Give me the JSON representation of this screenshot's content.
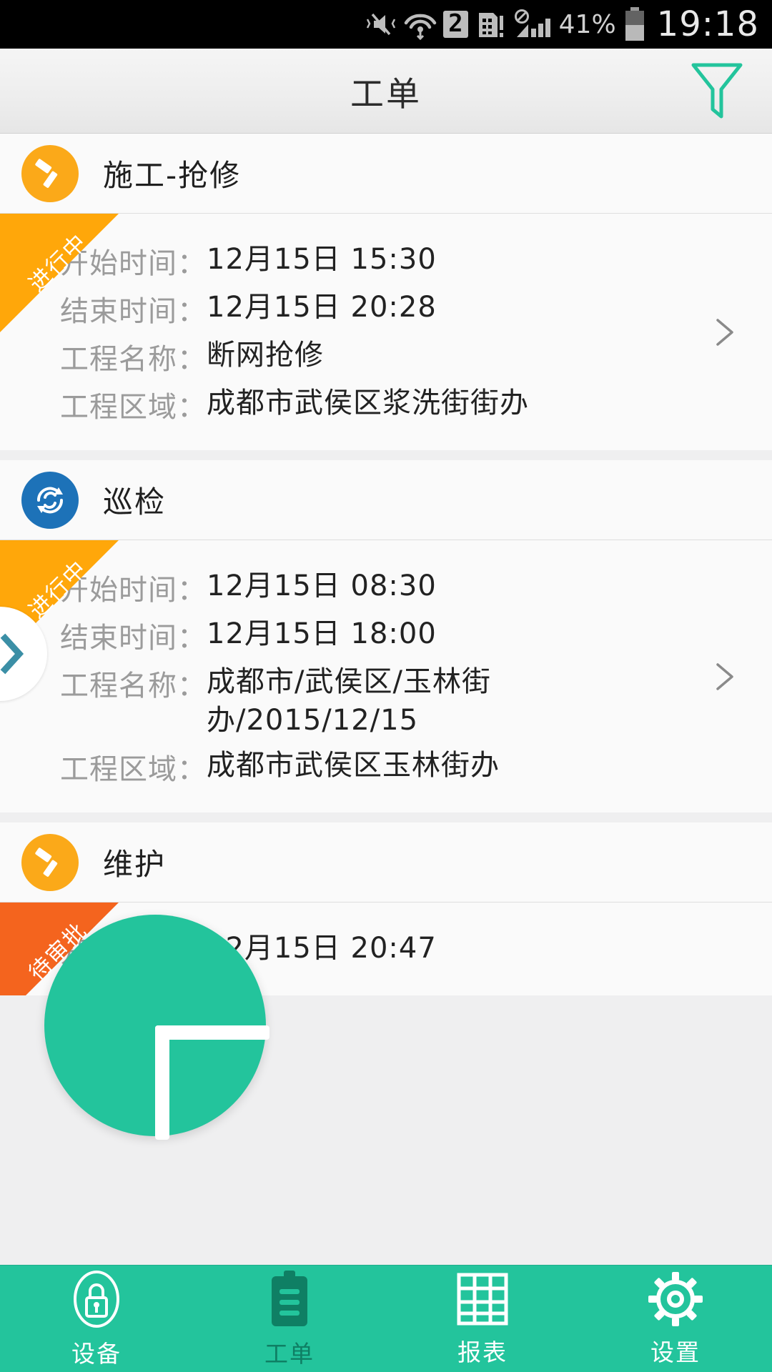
{
  "statusbar": {
    "sim_badge": "2",
    "battery_percent": "41%",
    "clock": "19:18",
    "icons": [
      "vibrate-mute-icon",
      "wifi-icon",
      "sim-2-icon",
      "sd-card-alert-icon",
      "no-signal-icon",
      "signal-bars-icon",
      "battery-icon"
    ]
  },
  "header": {
    "title": "工单",
    "filter_icon": "filter-funnel-icon",
    "accent_color": "#23C49C"
  },
  "labels": {
    "start_time": "开始时间：",
    "end_time": "结束时间：",
    "project_name": "工程名称：",
    "project_area": "工程区域："
  },
  "status_colors": {
    "in_progress": "#FFA70A",
    "pending_approval": "#F4641E"
  },
  "cards": [
    {
      "icon": "hammer-icon",
      "icon_color": "#FBA919",
      "title": "施工-抢修",
      "ribbon": "进行中",
      "ribbon_type": "in_progress",
      "start_time": "12月15日 15:30",
      "end_time": "12月15日 20:28",
      "project_name": "断网抢修",
      "project_area": "成都市武侯区浆洗街街办"
    },
    {
      "icon": "refresh-cycle-icon",
      "icon_color": "#1D72B8",
      "title": "巡检",
      "ribbon": "进行中",
      "ribbon_type": "in_progress",
      "start_time": "12月15日 08:30",
      "end_time": "12月15日 18:00",
      "project_name": "成都市/武侯区/玉林街办/2015/12/15",
      "project_area": "成都市武侯区玉林街办"
    },
    {
      "icon": "hammer-icon",
      "icon_color": "#FBA919",
      "title": "维护",
      "ribbon": "待审批",
      "ribbon_type": "pending_approval",
      "start_time": "12月15日 20:47",
      "end_time": "",
      "project_name": "",
      "project_area": ""
    }
  ],
  "fab": {
    "icon": "plus-icon",
    "color": "#23C49C"
  },
  "bottomnav": {
    "items": [
      {
        "label": "设备",
        "icon": "lock-icon",
        "active": false
      },
      {
        "label": "工单",
        "icon": "clipboard-icon",
        "active": true
      },
      {
        "label": "报表",
        "icon": "table-grid-icon",
        "active": false
      },
      {
        "label": "设置",
        "icon": "gear-icon",
        "active": false
      }
    ]
  }
}
